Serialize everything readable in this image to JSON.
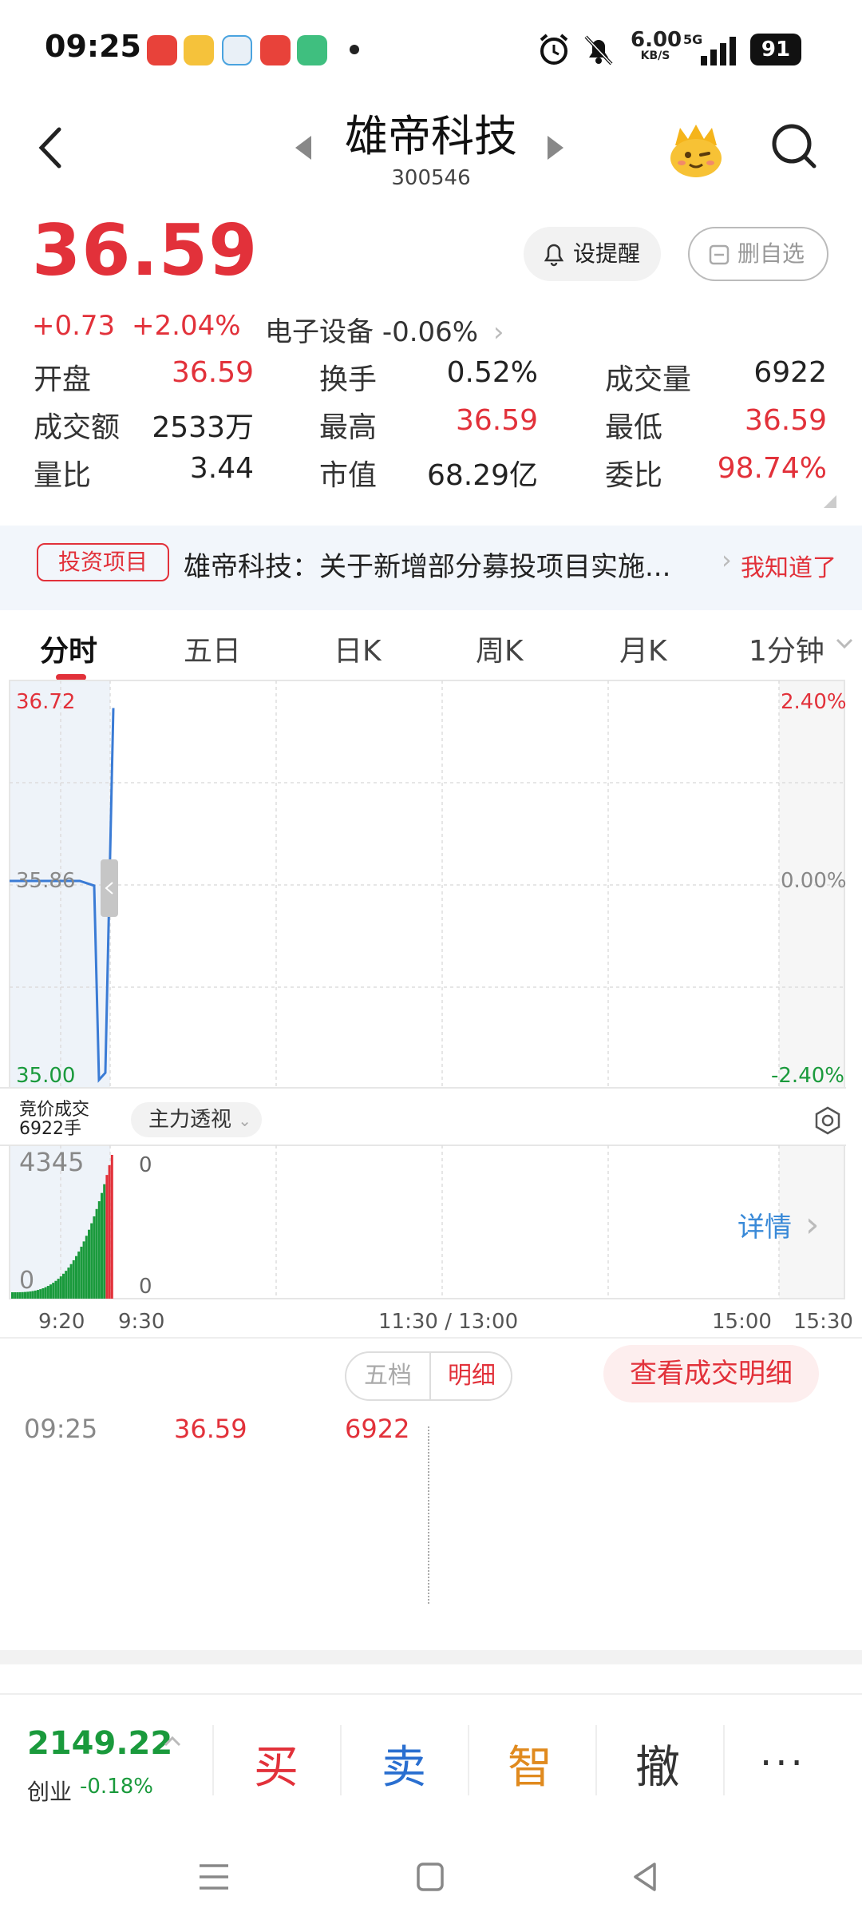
{
  "status_bar": {
    "time": "09:25",
    "speed_value": "6.00",
    "speed_unit": "KB/S",
    "network": "5G",
    "battery": "91"
  },
  "header": {
    "stock_name": "雄帝科技",
    "stock_code": "300546"
  },
  "quote": {
    "price": "36.59",
    "change": "+0.73",
    "change_pct": "+2.04%",
    "sector": "电子设备",
    "sector_change": "-0.06%",
    "alert_button": "设提醒",
    "watchlist_button": "删自选"
  },
  "metrics": [
    {
      "label": "开盘",
      "value": "36.59",
      "color": "red"
    },
    {
      "label": "换手",
      "value": "0.52%",
      "color": "dark"
    },
    {
      "label": "成交量",
      "value": "6922",
      "color": "dark"
    },
    {
      "label": "成交额",
      "value": "2533万",
      "color": "dark"
    },
    {
      "label": "最高",
      "value": "36.59",
      "color": "red"
    },
    {
      "label": "最低",
      "value": "36.59",
      "color": "red"
    },
    {
      "label": "量比",
      "value": "3.44",
      "color": "dark"
    },
    {
      "label": "市值",
      "value": "68.29亿",
      "color": "dark"
    },
    {
      "label": "委比",
      "value": "98.74%",
      "color": "red"
    }
  ],
  "news": {
    "tag": "投资项目",
    "text": "雄帝科技：关于新增部分募投项目实施...",
    "ack": "我知道了"
  },
  "tabs": [
    "分时",
    "五日",
    "日K",
    "周K",
    "月K",
    "1分钟"
  ],
  "chart": {
    "price_high": "36.72",
    "price_mid": "35.86",
    "price_low": "35.00",
    "pct_high": "2.40%",
    "pct_mid": "0.00%",
    "pct_low": "-2.40%",
    "auction_label_1": "竞价成交",
    "auction_label_2": "6922手",
    "indicator_button": "主力透视",
    "volume_max": "4345",
    "volume_zero": "0",
    "indicator_top": "0",
    "indicator_bottom": "0",
    "details_link": "详情",
    "time_labels": [
      "9:20",
      "9:30",
      "11:30 / 13:00",
      "15:00",
      "15:30"
    ]
  },
  "chart_data": {
    "type": "line",
    "title": "",
    "xlabel": "",
    "ylabel": "",
    "x": [
      "9:20",
      "9:21",
      "9:22",
      "9:23",
      "9:24",
      "9:24:30",
      "9:24:45",
      "9:25"
    ],
    "series": [
      {
        "values": [
          35.86,
          35.86,
          35.86,
          35.86,
          35.84,
          35.02,
          35.05,
          36.59
        ]
      }
    ],
    "ylim": [
      35.0,
      36.72
    ],
    "reference": 35.86,
    "volume_max": 4345
  },
  "trades": {
    "toggle_five": "五档",
    "toggle_detail": "明细",
    "view_button": "查看成交明细",
    "rows": [
      {
        "time": "09:25",
        "price": "36.59",
        "volume": "6922"
      }
    ]
  },
  "bottom": {
    "index_value": "2149.22",
    "index_name": "创业",
    "index_change": "-0.18%",
    "buy": "买",
    "sell": "卖",
    "smart": "智",
    "cancel": "撤",
    "more": "···"
  },
  "colors": {
    "up": "#e2313a",
    "down": "#1a9a3c",
    "price_line": "#3a7bd5",
    "link": "#3a8ad8"
  }
}
